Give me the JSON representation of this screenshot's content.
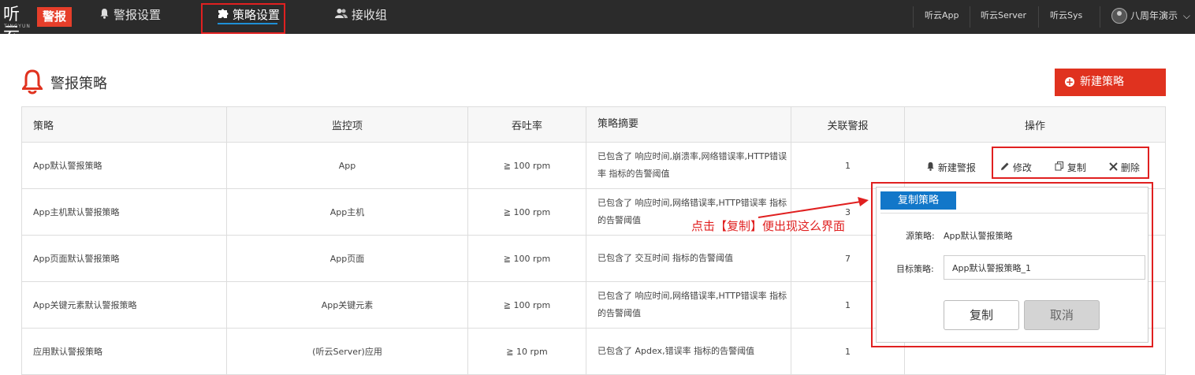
{
  "header": {
    "logo_text": "听云",
    "logo_sub": "TINGYUN",
    "logo_badge": "警报",
    "nav": [
      {
        "label": "警报设置",
        "icon": "bell-icon"
      },
      {
        "label": "策略设置",
        "icon": "puzzle-icon"
      },
      {
        "label": "接收组",
        "icon": "users-icon"
      }
    ],
    "right_links": [
      "听云App",
      "听云Server",
      "听云Sys"
    ],
    "user": "八周年演示"
  },
  "page": {
    "title": "警报策略",
    "new_button": "新建策略"
  },
  "table": {
    "headers": [
      "策略",
      "监控项",
      "吞吐率",
      "策略摘要",
      "关联警报",
      "操作"
    ],
    "rows": [
      {
        "strategy": "App默认警报策略",
        "monitor": "App",
        "throughput": "≧ 100 rpm",
        "summary": "已包含了 响应时间,崩溃率,网络错误率,HTTP错误率 指标的告警阈值",
        "related": "1"
      },
      {
        "strategy": "App主机默认警报策略",
        "monitor": "App主机",
        "throughput": "≧ 100 rpm",
        "summary": "已包含了 响应时间,网络错误率,HTTP错误率 指标的告警阈值",
        "related": "3"
      },
      {
        "strategy": "App页面默认警报策略",
        "monitor": "App页面",
        "throughput": "≧ 100 rpm",
        "summary": "已包含了 交互时间 指标的告警阈值",
        "related": "7"
      },
      {
        "strategy": "App关键元素默认警报策略",
        "monitor": "App关键元素",
        "throughput": "≧ 100 rpm",
        "summary": "已包含了 响应时间,网络错误率,HTTP错误率 指标的告警阈值",
        "related": "1"
      },
      {
        "strategy": "应用默认警报策略",
        "monitor": "(听云Server)应用",
        "throughput": "≧ 10 rpm",
        "summary": "已包含了 Apdex,错误率 指标的告警阈值",
        "related": "1"
      }
    ],
    "ops": {
      "new_alert": "新建警报",
      "edit": "修改",
      "copy": "复制",
      "delete": "删除"
    }
  },
  "dialog": {
    "tab": "复制策略",
    "source_label": "源策略:",
    "source_value": "App默认警报策略",
    "target_label": "目标策略:",
    "target_value": "App默认警报策略_1",
    "copy_button": "复制",
    "cancel_button": "取消"
  },
  "annotation": "点击【复制】便出现这么界面",
  "colors": {
    "topbar": "#2b2b2b",
    "accent_red": "#e0321f",
    "tab_blue": "#1277c9",
    "nav_underline": "#1e90d6"
  }
}
